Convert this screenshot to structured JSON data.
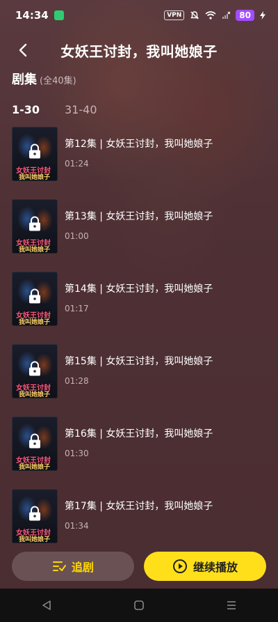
{
  "status_bar": {
    "time": "14:34",
    "vpn": "VPN",
    "battery": "80"
  },
  "header": {
    "title": "女妖王讨封，我叫她娘子"
  },
  "section": {
    "label": "剧集",
    "total": "(全40集)"
  },
  "tabs": [
    {
      "label": "1-30",
      "active": true
    },
    {
      "label": "31-40",
      "active": false
    }
  ],
  "thumb": {
    "line1": "女妖王讨封",
    "line2": "我叫她娘子"
  },
  "episodes": [
    {
      "title": "第12集 | 女妖王讨封，我叫她娘子",
      "duration": "01:24"
    },
    {
      "title": "第13集 | 女妖王讨封，我叫她娘子",
      "duration": "01:00"
    },
    {
      "title": "第14集 | 女妖王讨封，我叫她娘子",
      "duration": "01:17"
    },
    {
      "title": "第15集 | 女妖王讨封，我叫她娘子",
      "duration": "01:28"
    },
    {
      "title": "第16集 | 女妖王讨封，我叫她娘子",
      "duration": "01:30"
    },
    {
      "title": "第17集 | 女妖王讨封，我叫她娘子",
      "duration": "01:34"
    }
  ],
  "actions": {
    "follow_label": "追剧",
    "play_label": "继续播放"
  },
  "colors": {
    "accent_yellow": "#ffdf1a",
    "battery": "#a24dff"
  }
}
